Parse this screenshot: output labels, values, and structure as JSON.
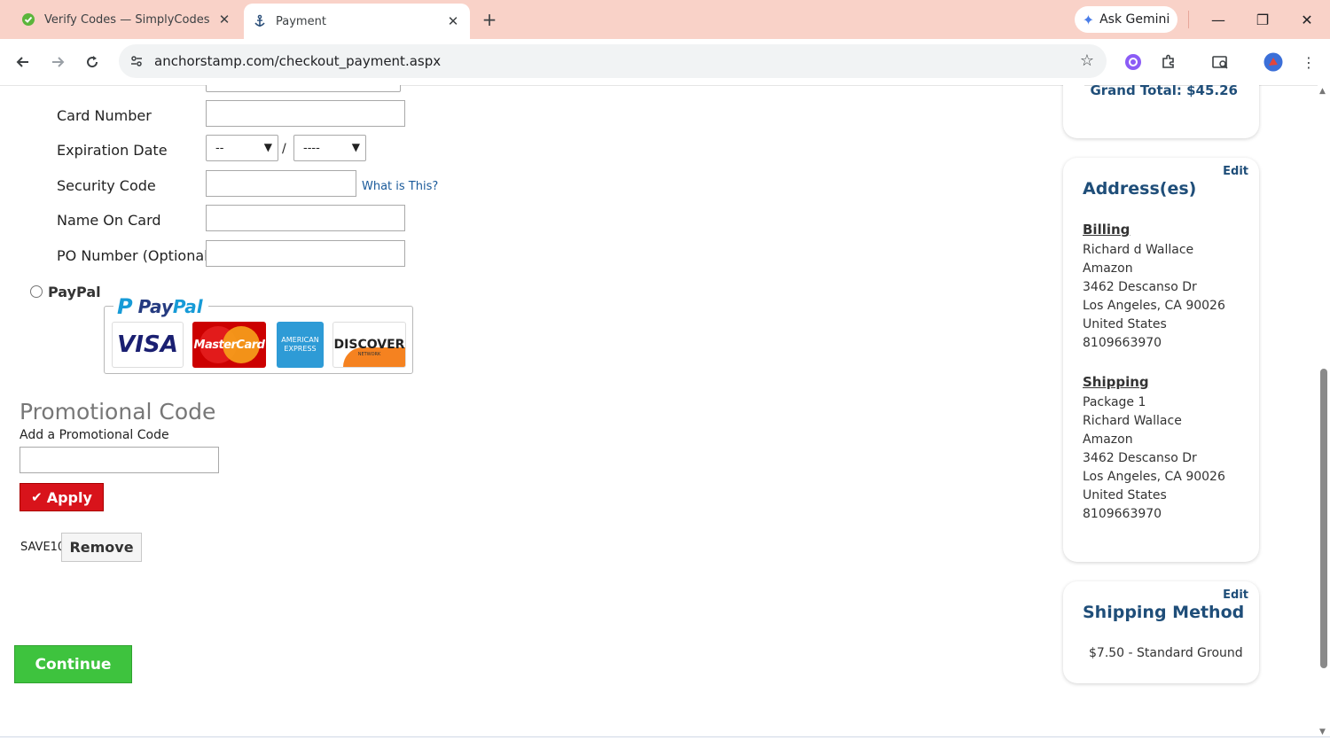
{
  "browser": {
    "tabs": [
      {
        "title": "Verify Codes — SimplyCodes",
        "icon": "simplycodes-icon"
      },
      {
        "title": "Payment",
        "icon": "anchor-icon"
      }
    ],
    "new_tab": "+",
    "ask_gemini": "Ask Gemini",
    "url": "anchorstamp.com/checkout_payment.aspx",
    "window_controls": {
      "minimize": "—",
      "restore": "❐",
      "close": "✕"
    }
  },
  "form": {
    "card_number_label": "Card Number",
    "expiration_label": "Expiration Date",
    "exp_month_value": "--",
    "exp_separator": "/",
    "exp_year_value": "----",
    "security_label": "Security Code",
    "what_is_this": "What is This?",
    "name_label": "Name On Card",
    "po_label": "PO Number (Optional)",
    "paypal_label": "PayPal",
    "paypal_logo_a": "Pay",
    "paypal_logo_b": "Pal",
    "cards": {
      "visa": "VISA",
      "mastercard": "MasterCard",
      "amex_1": "AMERICAN",
      "amex_2": "EXPRESS",
      "discover": "DISCOVER",
      "discover_sub": "NETWORK"
    }
  },
  "promo": {
    "heading": "Promotional Code",
    "label": "Add a Promotional Code",
    "apply_label": "Apply",
    "applied_code": "SAVE10",
    "remove_label": "Remove"
  },
  "continue_label": "Continue",
  "summary": {
    "grand_total": "Grand Total: $45.26"
  },
  "addresses": {
    "edit_label": "Edit",
    "heading": "Address(es)",
    "billing_heading": "Billing",
    "billing": [
      "Richard d Wallace",
      "Amazon",
      "3462 Descanso Dr",
      "Los Angeles, CA 90026",
      "United States",
      "8109663970"
    ],
    "shipping_heading": "Shipping",
    "shipping": [
      "Package 1",
      "Richard Wallace",
      "Amazon",
      "3462 Descanso Dr",
      "Los Angeles, CA 90026",
      "United States",
      "8109663970"
    ]
  },
  "shipping_method": {
    "edit_label": "Edit",
    "heading": "Shipping Method",
    "value": "$7.50 - Standard Ground"
  },
  "colors": {
    "tabbar": "#f9d2c8",
    "heading_blue": "#1f4e79",
    "apply_red": "#d8131b",
    "continue_green": "#3ec33e"
  }
}
